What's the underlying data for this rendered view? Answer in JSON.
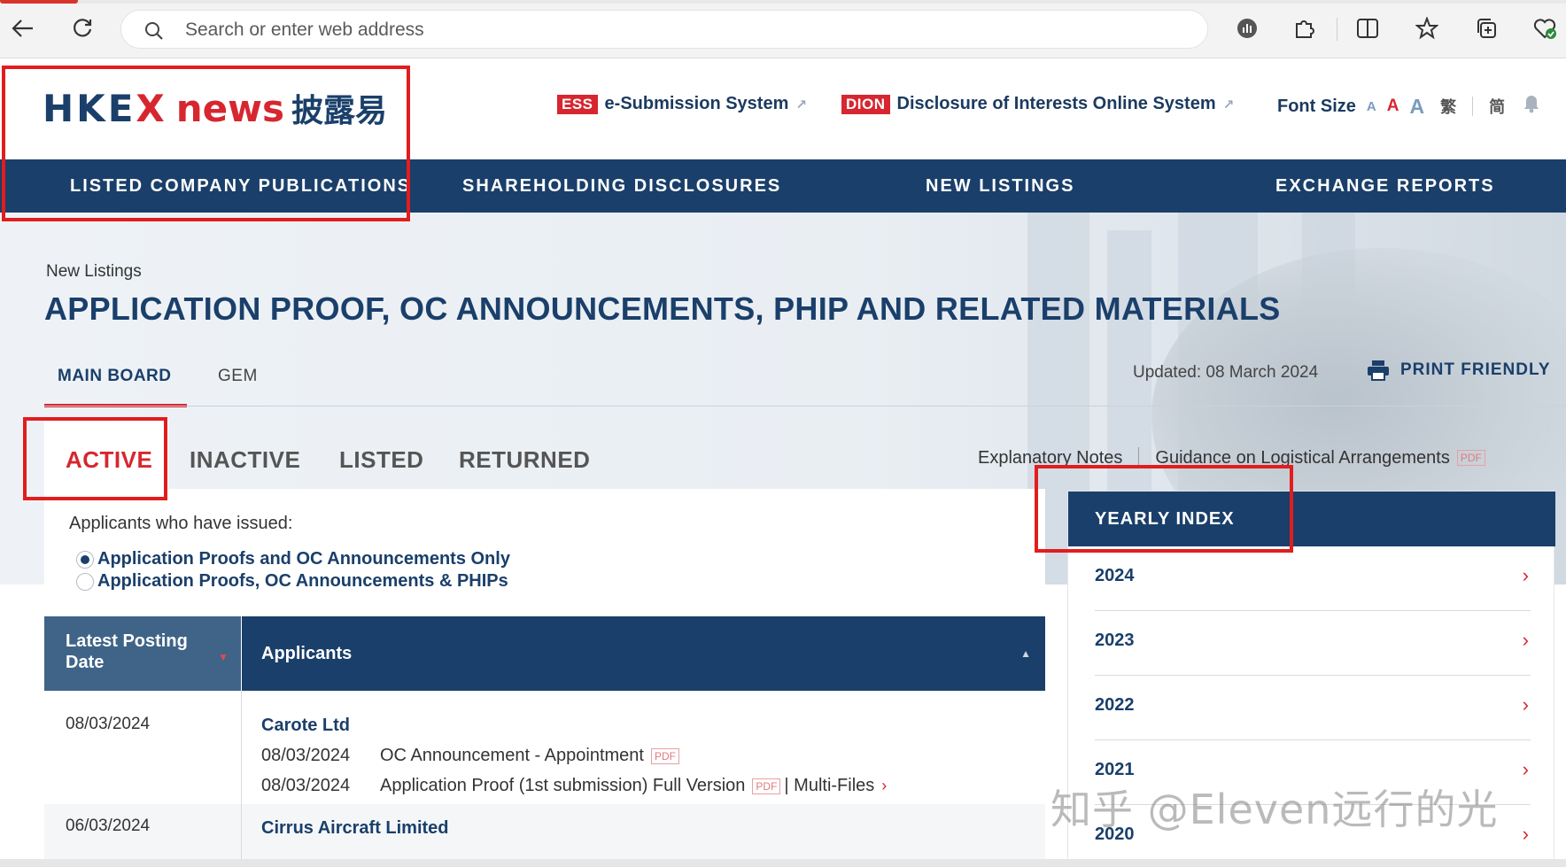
{
  "browser": {
    "address_placeholder": "Search or enter web address",
    "icons": [
      "back-arrow-icon",
      "refresh-icon",
      "search-icon",
      "extension-icon",
      "puzzle-icon",
      "split-screen-icon",
      "favorite-star-icon",
      "collections-icon",
      "browser-essentials-icon"
    ]
  },
  "header": {
    "logo": {
      "part1": "HKE",
      "x": "X",
      "part2": "news",
      "chinese": "披露易"
    },
    "ess": {
      "badge": "ESS",
      "label": "e-Submission System"
    },
    "dion": {
      "badge": "DION",
      "label": "Disclosure of Interests Online System"
    },
    "font_size": {
      "label": "Font Size",
      "small": "A",
      "medium": "A",
      "large": "A"
    },
    "lang_trad": "繁",
    "lang_simp": "简"
  },
  "nav": {
    "items": [
      "LISTED COMPANY PUBLICATIONS",
      "SHAREHOLDING DISCLOSURES",
      "NEW LISTINGS",
      "EXCHANGE REPORTS"
    ]
  },
  "page": {
    "breadcrumb": "New Listings",
    "title": "APPLICATION PROOF, OC ANNOUNCEMENTS, PHIP AND RELATED MATERIALS",
    "board_tabs": [
      "MAIN BOARD",
      "GEM"
    ],
    "updated": "Updated: 08 March 2024",
    "print_label": "PRINT FRIENDLY",
    "status_tabs": [
      "ACTIVE",
      "INACTIVE",
      "LISTED",
      "RETURNED"
    ],
    "explanatory_notes": "Explanatory Notes",
    "guidance": "Guidance on Logistical Arrangements",
    "pdf_tag": "PDF"
  },
  "filter": {
    "label": "Applicants who have issued:",
    "options": [
      "Application Proofs and OC Announcements Only",
      "Application Proofs, OC Announcements & PHIPs"
    ],
    "selected_index": 0
  },
  "table": {
    "headers": {
      "date": "Latest Posting Date",
      "applicants": "Applicants"
    },
    "rows": [
      {
        "date": "08/03/2024",
        "company": "Carote Ltd",
        "docs": [
          {
            "date": "08/03/2024",
            "title": "OC Announcement - Appointment",
            "tag": "PDF"
          },
          {
            "date": "08/03/2024",
            "title": "Application Proof (1st submission) Full Version",
            "tag": "PDF",
            "extra": "| Multi-Files"
          }
        ]
      },
      {
        "date": "06/03/2024",
        "company": "Cirrus Aircraft Limited"
      }
    ]
  },
  "yearly_index": {
    "title": "YEARLY INDEX",
    "years": [
      "2024",
      "2023",
      "2022",
      "2021",
      "2020"
    ]
  },
  "watermark": "知乎 @Eleven远行的光",
  "colors": {
    "navy": "#1a3f6a",
    "brand_red": "#d7262f",
    "annotation_red": "#e11d1d"
  }
}
